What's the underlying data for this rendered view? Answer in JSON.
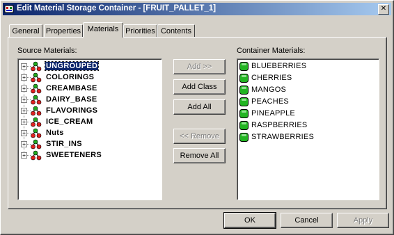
{
  "window": {
    "title": "Edit Material Storage Container - [FRUIT_PALLET_1]",
    "close_glyph": "✕"
  },
  "tabs": [
    {
      "label": "General",
      "active": false
    },
    {
      "label": "Properties",
      "active": false
    },
    {
      "label": "Materials",
      "active": true
    },
    {
      "label": "Priorities",
      "active": false
    },
    {
      "label": "Contents",
      "active": false
    }
  ],
  "source": {
    "label": "Source Materials:",
    "items": [
      {
        "label": "UNGROUPED",
        "selected": true
      },
      {
        "label": "COLORINGS",
        "selected": false
      },
      {
        "label": "CREAMBASE",
        "selected": false
      },
      {
        "label": "DAIRY_BASE",
        "selected": false
      },
      {
        "label": "FLAVORINGS",
        "selected": false
      },
      {
        "label": "ICE_CREAM",
        "selected": false
      },
      {
        "label": "Nuts",
        "selected": false
      },
      {
        "label": "STIR_INS",
        "selected": false
      },
      {
        "label": "SWEETENERS",
        "selected": false
      }
    ],
    "expander_glyph": "+"
  },
  "container": {
    "label": "Container Materials:",
    "items": [
      "BLUEBERRIES",
      "CHERRIES",
      "MANGOS",
      "PEACHES",
      "PINEAPPLE",
      "RASPBERRIES",
      "STRAWBERRIES"
    ]
  },
  "buttons": {
    "add": "Add >>",
    "add_class": "Add Class",
    "add_all": "Add All",
    "remove": "<< Remove",
    "remove_all": "Remove All",
    "ok": "OK",
    "cancel": "Cancel",
    "apply": "Apply"
  },
  "colors": {
    "title_start": "#0a246a",
    "title_end": "#a6caf0",
    "face": "#d4d0c8",
    "material_green": "#22b422"
  }
}
